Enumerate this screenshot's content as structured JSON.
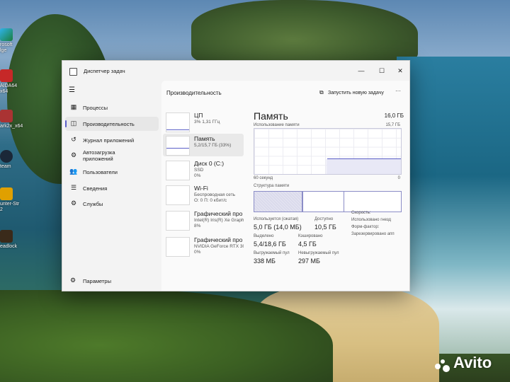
{
  "window": {
    "title": "Диспетчер задач",
    "min": "—",
    "max": "☐",
    "close": "✕"
  },
  "nav": {
    "items": [
      {
        "label": "Процессы",
        "icon": "grid-icon"
      },
      {
        "label": "Производительность",
        "icon": "performance-icon"
      },
      {
        "label": "Журнал приложений",
        "icon": "history-icon"
      },
      {
        "label": "Автозагрузка приложений",
        "icon": "startup-icon"
      },
      {
        "label": "Пользователи",
        "icon": "users-icon"
      },
      {
        "label": "Сведения",
        "icon": "details-icon"
      },
      {
        "label": "Службы",
        "icon": "services-icon"
      }
    ],
    "settings": "Параметры"
  },
  "header": {
    "title": "Производительность",
    "run_task": "Запустить новую задачу",
    "more": "···"
  },
  "perf_list": [
    {
      "name": "ЦП",
      "sub1": "3% 1,31 ГГц",
      "sub2": ""
    },
    {
      "name": "Память",
      "sub1": "5,2/15,7 ГБ (33%)",
      "sub2": ""
    },
    {
      "name": "Диск 0 (C:)",
      "sub1": "SSD",
      "sub2": "0%"
    },
    {
      "name": "Wi-Fi",
      "sub1": "Беспроводная сеть",
      "sub2": "О: 0 П: 0 кбит/с"
    },
    {
      "name": "Графический про",
      "sub1": "Intel(R) Iris(R) Xe Graphi",
      "sub2": "8%"
    },
    {
      "name": "Графический про",
      "sub1": "NVIDIA GeForce RTX 305",
      "sub2": "0%"
    }
  ],
  "memory": {
    "title": "Память",
    "total": "16,0 ГБ",
    "usage_label": "Использование памяти",
    "usage_max": "15,7 ГБ",
    "axis_left": "60 секунд",
    "axis_right": "0",
    "struct_label": "Структура памяти",
    "usage_fraction": 0.33,
    "stats": {
      "in_use_label": "Используется (сжатая)",
      "in_use": "5,0 ГБ (14,0 МБ)",
      "available_label": "Доступно",
      "available": "10,5 ГБ",
      "committed_label": "Выделено",
      "committed": "5,4/18,6 ГБ",
      "cached_label": "Кэшировано",
      "cached": "4,5 ГБ",
      "paged_label": "Выгружаемый пул",
      "paged": "338 МБ",
      "nonpaged_label": "Невыгружаемый пул",
      "nonpaged": "297 МБ"
    },
    "side": {
      "speed": "Скорость:",
      "slots": "Использовано гнезд",
      "form": "Форм-фактор:",
      "reserved": "Зарезервировано апп"
    }
  },
  "desktop": {
    "icons": [
      {
        "label": "rosoft\nlge"
      },
      {
        "label": "AIDA64\nx64"
      },
      {
        "label": "ark2x_x64"
      },
      {
        "label": "team"
      },
      {
        "label": "unter-Str\n2"
      },
      {
        "label": "eadlock"
      }
    ]
  },
  "watermark": "Avito"
}
